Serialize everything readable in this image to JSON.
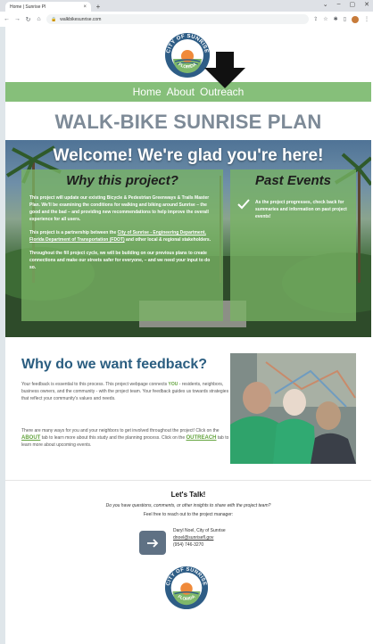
{
  "browser": {
    "tab_title": "Home | Sunrise Pl",
    "tab_close": "×",
    "new_tab": "+",
    "url": "walkbikesunrise.com",
    "win_min": "⌄",
    "win_dash": "–",
    "win_max": "▢",
    "win_close": "✕"
  },
  "logo": {
    "top_text": "CITY OF SUNRISE",
    "bottom_text": "FLORIDA"
  },
  "nav": {
    "items": [
      "Home",
      "About",
      "Outreach"
    ]
  },
  "main_title": "WALK-BIKE SUNRISE PLAN",
  "hero": {
    "title": "Welcome! We're glad you're here!",
    "why_title": "Why this project?",
    "why_p1": "This project will update our existing Bicycle & Pedestrian Greenways & Trails Master Plan. We'll be examining the conditions for walking and biking around Sunrise – the good and the bad – and providing new recommendations to help improve the overall experience for all users.",
    "why_p2_a": "This project is a partnership between the ",
    "why_p2_link": "City of Sunrise - Engineering Department, Florida Department of Transportation (FDOT)",
    "why_p2_b": " and other local & regional stakeholders.",
    "why_p3": "Throughout the fill project cycle, we will be building on our previous plans to create connections and make our streets safer for everyone, – and we need your input to do so.",
    "events_title": "Past Events",
    "events_text": "As the project progresses, check back for summaries and information on past project events!"
  },
  "feedback": {
    "title": "Why do we want feedback?",
    "p1_a": "Your feedback is essential to this process. This project webpage connects ",
    "p1_you": "YOU",
    "p1_b": " - residents, neighbors, business owners, and the community - with the project team. Your feedback guides us towards strategies that reflect your community's values and needs.",
    "p2_a": "There are many ways for you and your neighbors to get involved throughout the project! Click on the ",
    "p2_about": "ABOUT",
    "p2_b": " tab to learn more about this study and the planning process. Click on the ",
    "p2_outreach": "OUTREACH",
    "p2_c": " tab to learn more about upcoming events."
  },
  "contact": {
    "heading": "Let's Talk!",
    "question": "Do you have questions, comments, or other insights to share with the project team?",
    "reach": "Feel free to reach out to the project manager:",
    "name": "Daryl Noel",
    "org": ", City of Sunrise",
    "email": "dnoel@sunrisefl.gov",
    "phone": "(954) 746-3270"
  },
  "colors": {
    "nav_green": "#86bf7a",
    "title_gray": "#7d8a97",
    "heading_blue": "#2a5d80",
    "accent_green": "#63a33d"
  }
}
